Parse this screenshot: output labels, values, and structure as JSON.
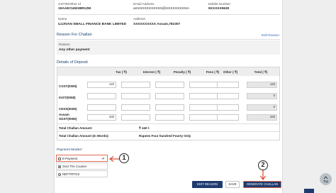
{
  "header": {
    "gstin_label": "GSTIN/Other Id",
    "gstin_value": "19AAECU6038R1ZM",
    "email_label": "Email Address",
    "email_value": "aXXXXXXXXXXXX@XXXXXXXXXm",
    "mobile_label": "Mobile Number",
    "mobile_value": "9XXXXX9630",
    "name_label": "Name",
    "name_value": "UJJIVAN SMALL FINANCE BANK LIMITED",
    "address_label": "Address",
    "address_value": "XXXXXXXXXX Assam,781007"
  },
  "reason": {
    "title": "Reason For Challan",
    "edit_link": "Edit Reason",
    "label": "Reason",
    "value": "Any other payment"
  },
  "deposit": {
    "title": "Details of Deposit",
    "columns": [
      "Tax ( ₹)",
      "Interest ( ₹)",
      "Penalty ( ₹)",
      "Fees ( ₹)",
      "Other ( ₹)",
      "Total ( ₹)"
    ],
    "rows": [
      {
        "label": "CGST(0005)",
        "tax": "120",
        "total": "120"
      },
      {
        "label": "IGST(0008)",
        "tax": "",
        "total": "0"
      },
      {
        "label": "CESS(0009)",
        "tax": "",
        "total": "0"
      },
      {
        "label1": "Assam",
        "label2": "SGST(0006)",
        "tax": "330",
        "total": "330"
      }
    ],
    "total_amount_label": "Total Challan Amount:",
    "total_amount_value": "₹ 440 /-",
    "total_words_label": "Total Challan Amount (In Words):",
    "total_words_value": "Rupees Four hundred Fourty Only"
  },
  "payment": {
    "modes_label": "Payment Modes",
    "required_mark": "*",
    "options": [
      {
        "label": "E-Payment",
        "checkmark": "✔"
      },
      {
        "label": "Over The Counter"
      },
      {
        "label": "NEFT/RTGS"
      }
    ]
  },
  "buttons": {
    "edit_reason": "EDIT REASON",
    "save": "SAVE",
    "generate_challan": "GENERATE CHALLAN"
  },
  "annotations": {
    "step1": "1",
    "step2": "2"
  },
  "top_button": "Top",
  "colors": {
    "primary": "#1f3b6e",
    "annotation": "#d9472b",
    "highlight": "#e26a4d"
  }
}
